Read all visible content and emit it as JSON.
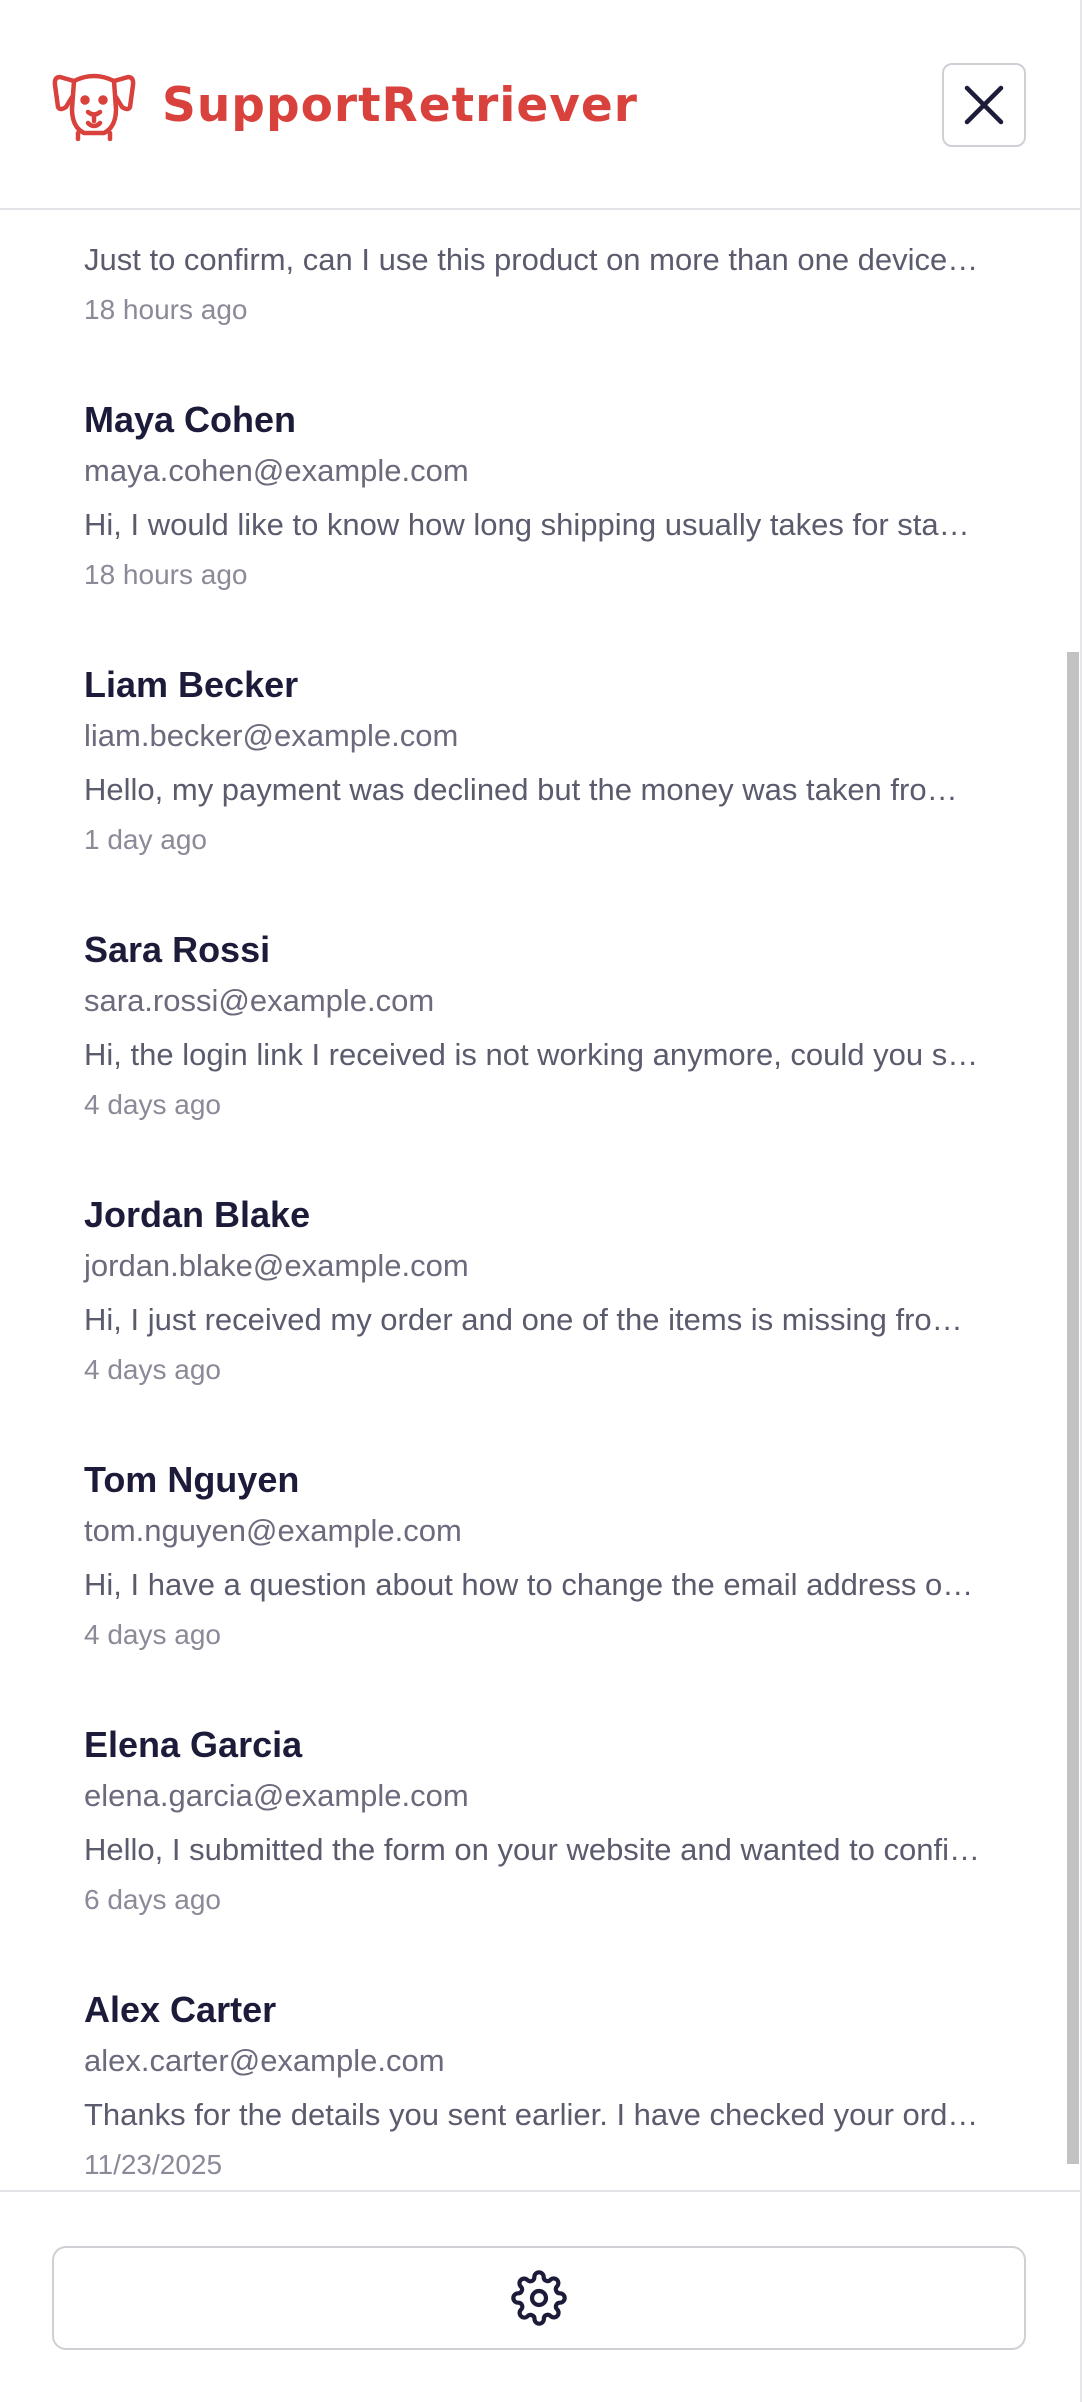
{
  "app": {
    "brand_name": "SupportRetriever",
    "brand_color": "#d9413c",
    "logo_icon": "dog-face-icon",
    "close_icon": "close-icon",
    "settings_icon": "gear-icon"
  },
  "conversations": [
    {
      "name": "",
      "email": "",
      "message": "Just to confirm, can I use this product on more than one device…",
      "time": "18 hours ago"
    },
    {
      "name": "Maya Cohen",
      "email": "maya.cohen@example.com",
      "message": "Hi, I would like to know how long shipping usually takes for sta…",
      "time": "18 hours ago"
    },
    {
      "name": "Liam Becker",
      "email": "liam.becker@example.com",
      "message": "Hello, my payment was declined but the money was taken fro…",
      "time": "1 day ago"
    },
    {
      "name": "Sara Rossi",
      "email": "sara.rossi@example.com",
      "message": "Hi, the login link I received is not working anymore, could you s…",
      "time": "4 days ago"
    },
    {
      "name": "Jordan Blake",
      "email": "jordan.blake@example.com",
      "message": "Hi, I just received my order and one of the items is missing fro…",
      "time": "4 days ago"
    },
    {
      "name": "Tom Nguyen",
      "email": "tom.nguyen@example.com",
      "message": "Hi, I have a question about how to change the email address o…",
      "time": "4 days ago"
    },
    {
      "name": "Elena Garcia",
      "email": "elena.garcia@example.com",
      "message": "Hello, I submitted the form on your website and wanted to confi…",
      "time": "6 days ago"
    },
    {
      "name": "Alex Carter",
      "email": "alex.carter@example.com",
      "message": "Thanks for the details you sent earlier. I have checked your ord…",
      "time": "11/23/2025"
    }
  ]
}
